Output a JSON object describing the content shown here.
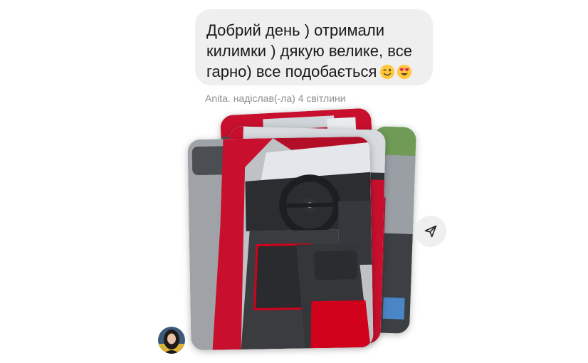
{
  "message": {
    "text": "Добрий день ) отримали\nкилимки ) дякую велике, все\nгарно) все подобається",
    "emojis": [
      "winking-face-emoji",
      "heart-eyes-emoji"
    ]
  },
  "attachment_caption": "Anita. надіслав(-ла) 4 світлини",
  "photos": {
    "count": 4,
    "subject": "car-interior-photo"
  },
  "icons": {
    "share": "paper-plane-icon",
    "avatar": "user-avatar"
  },
  "colors": {
    "bubble": "#efeff0",
    "caption": "#8e8e93",
    "car_body": "#c8102e",
    "mat_accent": "#d0021b"
  }
}
